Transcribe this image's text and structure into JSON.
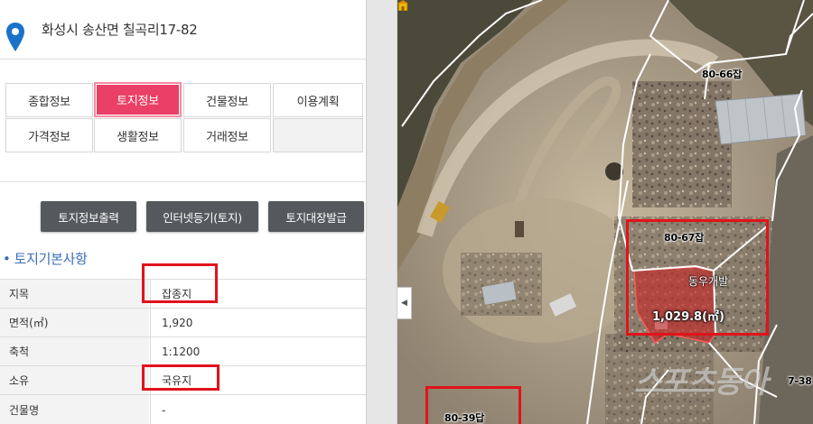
{
  "address": "화성시 송산면 칠곡리17-82",
  "tabs": [
    {
      "label": "종합정보",
      "active": false
    },
    {
      "label": "토지정보",
      "active": true
    },
    {
      "label": "건물정보",
      "active": false
    },
    {
      "label": "이용계획",
      "active": false
    },
    {
      "label": "가격정보",
      "active": false
    },
    {
      "label": "생활정보",
      "active": false
    },
    {
      "label": "거래정보",
      "active": false
    }
  ],
  "actions": {
    "print_label": "토지정보출력",
    "registry_label": "인터넷등기(토지)",
    "ledger_label": "토지대장발급"
  },
  "section": {
    "bullet": "•",
    "title": "토지기본사항"
  },
  "land_info": [
    {
      "label": "지목",
      "value": "잡종지"
    },
    {
      "label": "면적(㎡)",
      "value": "1,920"
    },
    {
      "label": "축척",
      "value": "1:1200"
    },
    {
      "label": "소유",
      "value": "국유지"
    },
    {
      "label": "건물명",
      "value": "-"
    }
  ],
  "map": {
    "parcel_labels": [
      "80-66잡",
      "80-67잡",
      "80-39답",
      "7-38"
    ],
    "area_label": "1,029.8(㎡)",
    "company_label": "동우개발",
    "watermark": "스포츠동아",
    "collapse_arrow": "◀"
  },
  "colors": {
    "active_tab": "#ea3f66",
    "action_button": "#55585c",
    "section_title": "#3a6fb7",
    "highlight_box": "#e1131b",
    "pin": "#1a73c9"
  }
}
